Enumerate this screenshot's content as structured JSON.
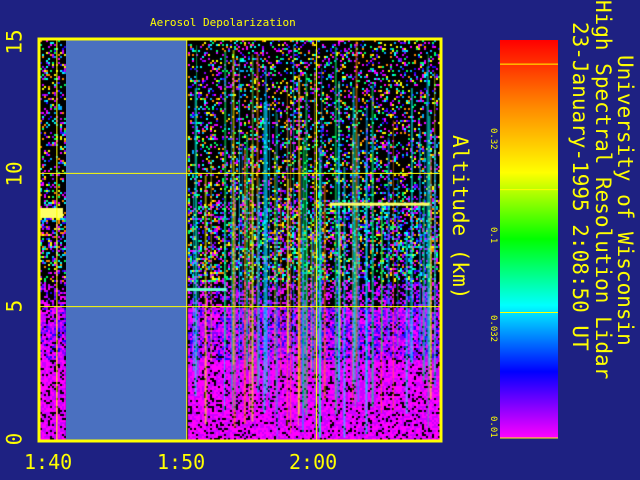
{
  "chart_data": {
    "type": "heatmap",
    "title": "Aerosol Depolarization",
    "ylabel": "Altitude (km)",
    "ylim": [
      0,
      15
    ],
    "yticks": [
      "0",
      "5",
      "10",
      "15"
    ],
    "xticks": [
      "1:40",
      "1:50",
      "2:00"
    ],
    "x_tick_values_min": [
      100,
      110,
      120
    ],
    "xlim_min": [
      98.7,
      129.5
    ],
    "grid": true,
    "no_data_region_min": [
      100.7,
      110.0
    ],
    "colorbar": {
      "scale": "log",
      "ticks": [
        "0.32",
        "0.1",
        "0.032",
        "0.01"
      ],
      "tick_values": [
        0.32,
        0.1,
        0.032,
        0.01
      ],
      "range": [
        0.01,
        0.4
      ],
      "colors": [
        "#ff00ff",
        "#0000ff",
        "#00ffff",
        "#00ff00",
        "#ffff00",
        "#ff8800",
        "#ff0000"
      ]
    }
  },
  "header": {
    "line1": "University of Wisconsin",
    "line2": "High Spectral Resolution Lidar",
    "line3": "23-January-1995  2:08:50 UT"
  },
  "colors": {
    "background": "#1e2182",
    "frame": "#ffff00",
    "nodata": "#4a70c0"
  }
}
